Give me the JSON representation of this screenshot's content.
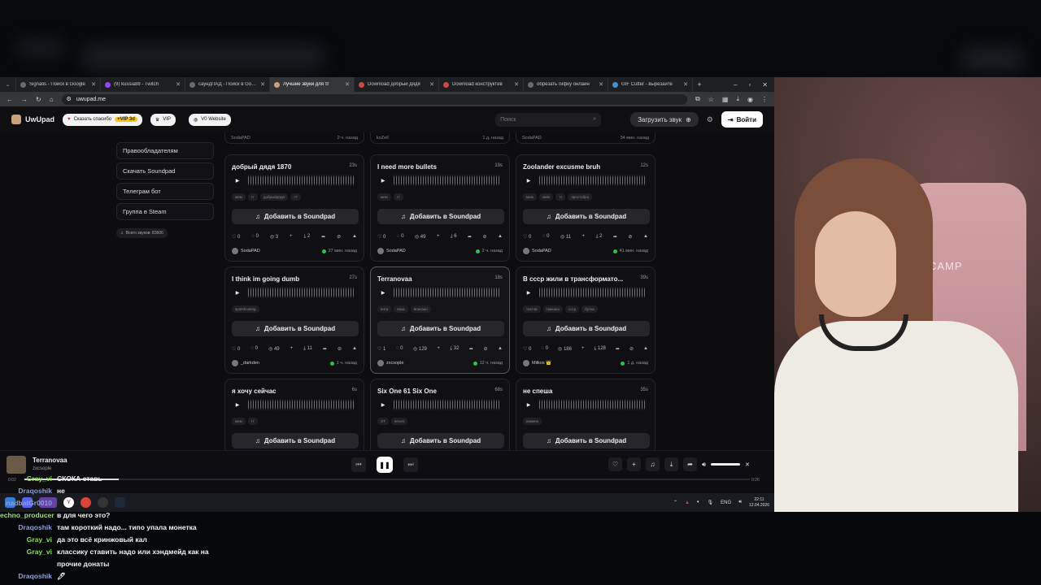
{
  "tabs": [
    {
      "label": "Signalis - Поиск в Google",
      "active": false
    },
    {
      "label": "(9) kussia88 - Twitch",
      "active": false
    },
    {
      "label": "саундПАД - Поиск в Google",
      "active": false
    },
    {
      "label": "Лучшие звуки для тг",
      "active": true
    },
    {
      "label": "Download добрый дядя",
      "active": false
    },
    {
      "label": "Download конструктив",
      "active": false
    },
    {
      "label": "обрезать гифку онлайн",
      "active": false
    },
    {
      "label": "GIF Cutter - вырезайте",
      "active": false
    }
  ],
  "address": {
    "url": "uwupad.me"
  },
  "site": {
    "logo": "UwUpad",
    "thanks_label": "Сказать спасибо",
    "thanks_badge": "+VIP 3d",
    "vip_label": "VIP",
    "v0_label": "V0 Website",
    "search_placeholder": "Поиск",
    "upload_label": "Загрузить звук",
    "login_label": "Войти"
  },
  "sidebar": {
    "items": [
      "Правообладателям",
      "Скачать Soundpad",
      "Телеграм бот",
      "Группа в Steam"
    ],
    "total": "Всего звуков: 83606"
  },
  "top_partial": [
    {
      "author": "SodaPAD",
      "time": "2 ч. назад"
    },
    {
      "author": "koZell",
      "time": "1 д. назад"
    },
    {
      "author": "SodaPAD",
      "time": "34 мин. назад"
    }
  ],
  "add_label": "Добавить в Soundpad",
  "cards": [
    {
      "title": "добрый дядя 1870",
      "dur": "23s",
      "tags": [
        "мем",
        "тт",
        "добрыйдядя",
        "+7"
      ],
      "likes": "0",
      "comments": "0",
      "plays": "3",
      "downloads": "2",
      "author": "SodaPAD",
      "time": "27 мин. назад"
    },
    {
      "title": "I need more bullets",
      "dur": "19s",
      "tags": [
        "мем",
        "тт"
      ],
      "likes": "0",
      "comments": "0",
      "plays": "49",
      "downloads": "6",
      "author": "SodaPAD",
      "time": "2 ч. назад"
    },
    {
      "title": "Zoolander excusme bruh",
      "dur": "12s",
      "tags": [
        "мем",
        "хайп",
        "тт",
        "простобро"
      ],
      "likes": "0",
      "comments": "0",
      "plays": "11",
      "downloads": "2",
      "author": "SodaPAD",
      "time": "41 мин. назад"
    },
    {
      "title": "I think im going dumb",
      "dur": "27s",
      "tags": [
        "spotshooting"
      ],
      "likes": "0",
      "comments": "0",
      "plays": "49",
      "downloads": "11",
      "author": "_darkden",
      "time": "1 ч. назад"
    },
    {
      "title": "Terranovaa",
      "dur": "18s",
      "tags": [
        "terra",
        "ваза",
        "9navaan"
      ],
      "likes": "1",
      "comments": "0",
      "plays": "129",
      "downloads": "32",
      "author": "zxcsople",
      "time": "12 ч. назад"
    },
    {
      "title": "В ссср жили в трансформато...",
      "dur": "39s",
      "tags": [
        "тиктов",
        "смешно",
        "ссср",
        "бутка"
      ],
      "likes": "0",
      "comments": "0",
      "plays": "186",
      "downloads": "128",
      "author": "Milkos 👑",
      "time": "1 д. назад"
    },
    {
      "title": "я хочу сейчас",
      "dur": "6s",
      "tags": [
        "мем",
        "тт"
      ]
    },
    {
      "title": "Six One 61 Six One",
      "dur": "68s",
      "tags": [
        "ST",
        "песня"
      ]
    },
    {
      "title": "не спеша",
      "dur": "35s",
      "tags": [
        "каменн"
      ]
    }
  ],
  "player": {
    "title": "Terranovaa",
    "author": "zxcsople",
    "time_start": "0:02",
    "time_end": "0:26",
    "progress": 0.13
  },
  "taskbar": {
    "lang": "ENG",
    "time": "22:11",
    "date": "12.04.2026"
  },
  "webcam": {
    "chair_text": "R CAMP"
  },
  "chat": [
    {
      "user": "Gray_vi",
      "color": "#8fdc5a",
      "text": "СКОКА ставь"
    },
    {
      "user": "Draqoshik",
      "color": "#8f9fd8",
      "text": "не"
    },
    {
      "user": "nadbatGr0010",
      "color": "#8f9fd8",
      "text": ""
    },
    {
      "user": "echno_producer",
      "color": "#9fdd7b",
      "text": "в для чего это?"
    },
    {
      "user": "Draqoshik",
      "color": "#8f9fd8",
      "text": "там короткий надо... типо упала монетка"
    },
    {
      "user": "Gray_vi",
      "color": "#8fdc5a",
      "text": "да это всё кринжовый кал"
    },
    {
      "user": "Gray_vi",
      "color": "#8fdc5a",
      "text": "классику ставить надо или хэндмейд как на прочие донаты"
    },
    {
      "user": "Draqoshik",
      "color": "#8f9fd8",
      "text": "🖊"
    }
  ]
}
